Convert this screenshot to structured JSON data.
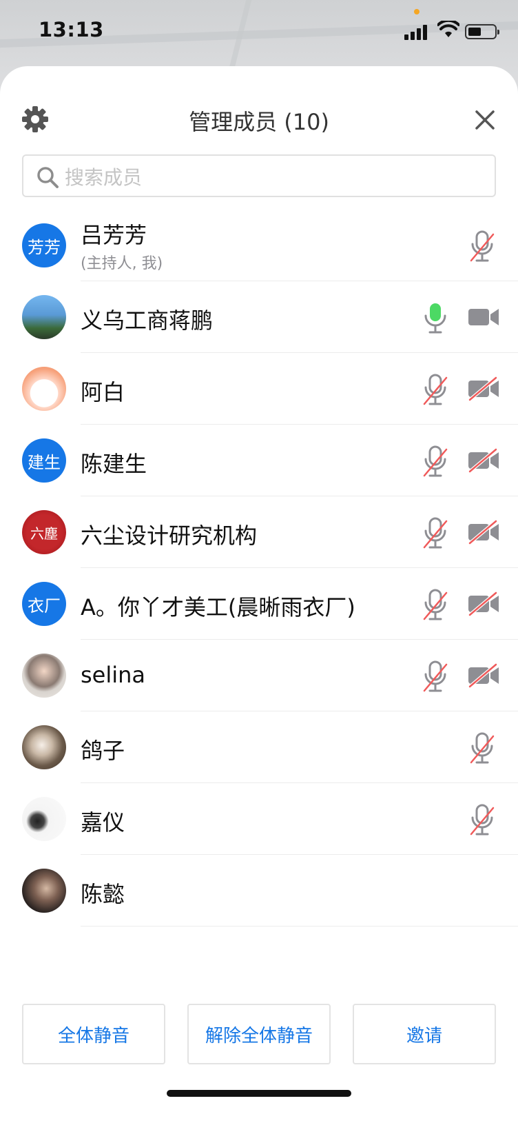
{
  "status_bar": {
    "time": "13:13"
  },
  "header": {
    "title": "管理成员 (10)"
  },
  "search": {
    "placeholder": "搜索成员"
  },
  "colors": {
    "accent": "#1677e6",
    "avatar_blue": "#1677e6",
    "mic_active": "#4cd964",
    "mute_red": "#f05a5a"
  },
  "members": [
    {
      "name": "吕芳芳",
      "sub": "(主持人, 我)",
      "avatar_text": "芳芳",
      "avatar": "blue",
      "mic": "muted",
      "cam": "none"
    },
    {
      "name": "义乌工商蒋鹏",
      "avatar_text": "",
      "avatar": "photo-sky",
      "mic": "active",
      "cam": "on"
    },
    {
      "name": "阿白",
      "avatar_text": "",
      "avatar": "photo-cartoon",
      "mic": "muted",
      "cam": "off"
    },
    {
      "name": "陈建生",
      "avatar_text": "建生",
      "avatar": "blue",
      "mic": "muted",
      "cam": "off"
    },
    {
      "name": "六尘设计研究机构",
      "avatar_text": "六塵",
      "avatar": "red-logo",
      "mic": "muted",
      "cam": "off"
    },
    {
      "name": "A。你丫才美工(晨晰雨衣厂)",
      "avatar_text": "衣厂",
      "avatar": "blue",
      "mic": "muted",
      "cam": "off"
    },
    {
      "name": "selina",
      "avatar_text": "",
      "avatar": "photo-portrait",
      "mic": "muted",
      "cam": "off"
    },
    {
      "name": "鸽子",
      "avatar_text": "",
      "avatar": "photo-outdoor",
      "mic": "muted",
      "cam": "none"
    },
    {
      "name": "嘉仪",
      "avatar_text": "",
      "avatar": "photo-white",
      "mic": "muted",
      "cam": "none"
    },
    {
      "name": "陈懿",
      "avatar_text": "",
      "avatar": "photo-dark",
      "mic": "none",
      "cam": "none"
    }
  ],
  "actions": {
    "mute_all": "全体静音",
    "unmute_all": "解除全体静音",
    "invite": "邀请"
  }
}
